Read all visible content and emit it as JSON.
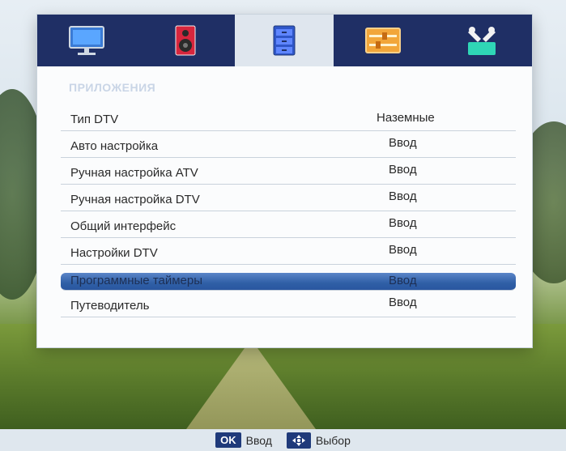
{
  "menu": {
    "section_title": "ПРИЛОЖЕНИЯ",
    "tabs": [
      {
        "name": "picture",
        "icon": "monitor-icon"
      },
      {
        "name": "sound",
        "icon": "speaker-icon"
      },
      {
        "name": "applications",
        "icon": "cabinet-icon",
        "active": true
      },
      {
        "name": "settings",
        "icon": "sliders-icon"
      },
      {
        "name": "tools",
        "icon": "tools-icon"
      }
    ],
    "items": [
      {
        "label": "Тип DTV",
        "value": "Наземные"
      },
      {
        "label": "Авто настройка",
        "value": "Ввод"
      },
      {
        "label": "Ручная настройка ATV",
        "value": "Ввод"
      },
      {
        "label": "Ручная настройка DTV",
        "value": "Ввод"
      },
      {
        "label": "Общий интерфейс",
        "value": "Ввод"
      },
      {
        "label": "Настройки DTV",
        "value": "Ввод"
      },
      {
        "label": "Программные таймеры",
        "value": "Ввод",
        "selected": true
      },
      {
        "label": "Путеводитель",
        "value": "Ввод"
      }
    ]
  },
  "footer": {
    "ok_key": "OK",
    "ok_label": "Ввод",
    "nav_label": "Выбор"
  },
  "colors": {
    "tab_bar": "#1f2f65",
    "active_tab": "#dfe6ee",
    "selection": "#2f5fa6"
  }
}
